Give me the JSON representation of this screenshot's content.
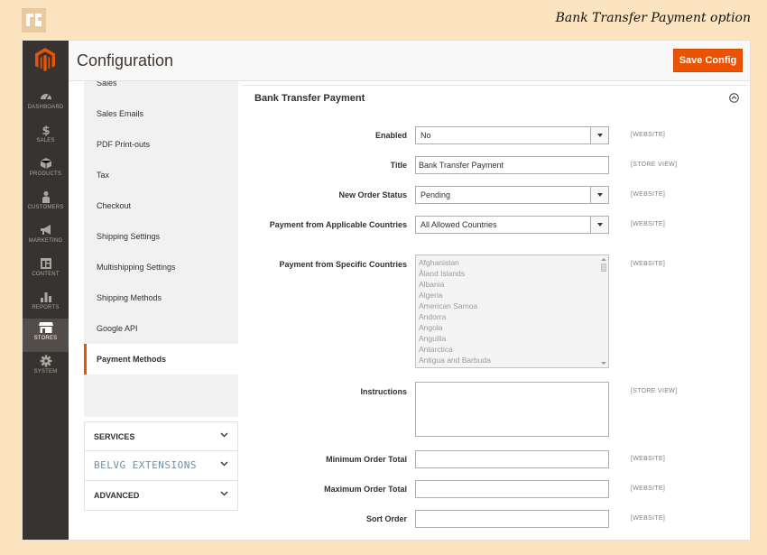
{
  "caption": "Bank Transfer Payment option",
  "header": {
    "title": "Configuration",
    "save_label": "Save Config"
  },
  "nav": [
    {
      "label": "DASHBOARD",
      "icon": "dashboard-icon"
    },
    {
      "label": "SALES",
      "icon": "dollar-icon"
    },
    {
      "label": "PRODUCTS",
      "icon": "box-icon"
    },
    {
      "label": "CUSTOMERS",
      "icon": "person-icon"
    },
    {
      "label": "MARKETING",
      "icon": "megaphone-icon"
    },
    {
      "label": "CONTENT",
      "icon": "layout-icon"
    },
    {
      "label": "REPORTS",
      "icon": "bar-chart-icon"
    },
    {
      "label": "STORES",
      "icon": "store-icon",
      "active": true
    },
    {
      "label": "SYSTEM",
      "icon": "gear-icon"
    }
  ],
  "sidebar": {
    "items": [
      "Sales",
      "Sales Emails",
      "PDF Print-outs",
      "Tax",
      "Checkout",
      "Shipping Settings",
      "Multishipping Settings",
      "Shipping Methods",
      "Google API",
      "Payment Methods"
    ],
    "active": "Payment Methods",
    "groups": [
      "SERVICES",
      "BELVG EXTENSIONS",
      "ADVANCED"
    ]
  },
  "section": {
    "title": "Bank Transfer Payment",
    "fields": {
      "enabled": {
        "label": "Enabled",
        "value": "No",
        "scope": "[WEBSITE]"
      },
      "title": {
        "label": "Title",
        "value": "Bank Transfer Payment",
        "scope": "[STORE VIEW]"
      },
      "new_order_status": {
        "label": "New Order Status",
        "value": "Pending",
        "scope": "[WEBSITE]"
      },
      "applicable_countries": {
        "label": "Payment from Applicable Countries",
        "value": "All Allowed Countries",
        "scope": "[WEBSITE]"
      },
      "specific_countries": {
        "label": "Payment from Specific Countries",
        "scope": "[WEBSITE]",
        "options": [
          "Afghanistan",
          "Åland Islands",
          "Albania",
          "Algeria",
          "American Samoa",
          "Andorra",
          "Angola",
          "Anguilla",
          "Antarctica",
          "Antigua and Barbuda"
        ]
      },
      "instructions": {
        "label": "Instructions",
        "value": "",
        "scope": "[STORE VIEW]"
      },
      "min_order_total": {
        "label": "Minimum Order Total",
        "value": "",
        "scope": "[WEBSITE]"
      },
      "max_order_total": {
        "label": "Maximum Order Total",
        "value": "",
        "scope": "[WEBSITE]"
      },
      "sort_order": {
        "label": "Sort Order",
        "value": "",
        "scope": "[WEBSITE]"
      }
    }
  },
  "colors": {
    "accent": "#eb5202",
    "admin_bar": "#373330",
    "page_bg": "#fde4c0"
  }
}
